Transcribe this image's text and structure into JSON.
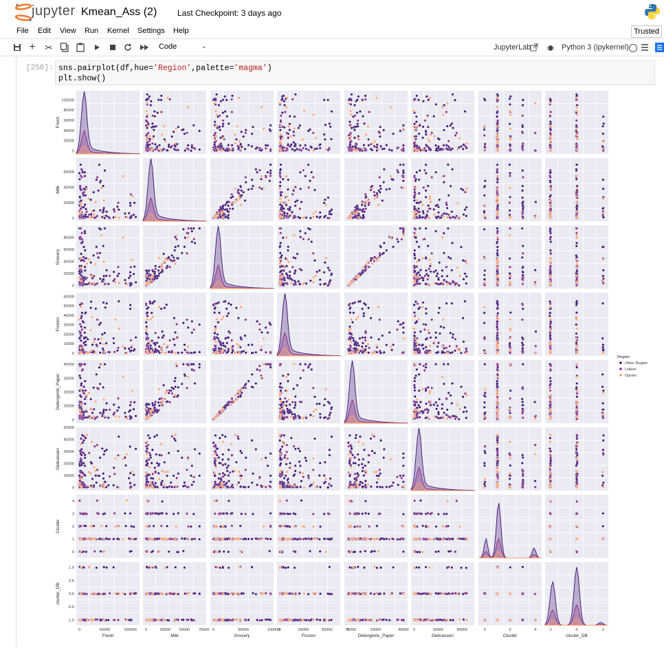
{
  "header": {
    "logo_text": "jupyter",
    "notebook_title": "Kmean_Ass (2)",
    "checkpoint": "Last Checkpoint: 3 days ago"
  },
  "menu": {
    "items": [
      "File",
      "Edit",
      "View",
      "Run",
      "Kernel",
      "Settings",
      "Help"
    ],
    "trusted": "Trusted"
  },
  "toolbar": {
    "icons": [
      "save-icon",
      "add-cell-icon",
      "cut-icon",
      "copy-icon",
      "paste-icon",
      "run-icon",
      "stop-icon",
      "restart-icon",
      "fast-forward-icon"
    ],
    "cell_type": "Code",
    "jupyterlab": "JupyterLab",
    "kernel": "Python 3 (ipykernel)"
  },
  "cell": {
    "prompt": "[250]:",
    "code_line1_fn": "sns.pairplot",
    "code_line1_args_a": "(df,hue=",
    "code_line1_str1": "'Region'",
    "code_line1_args_b": ",palette=",
    "code_line1_str2": "'magma'",
    "code_line1_end": ")",
    "code_line2": "plt.show()"
  },
  "chart_data": {
    "type": "scatter",
    "subtype": "pairplot",
    "variables": [
      "Fresh",
      "Milk",
      "Grocery",
      "Frozen",
      "Detergents_Paper",
      "Delicassen",
      "Cluster",
      "cluster_DB"
    ],
    "hue": "Region",
    "legend": {
      "title": "Region",
      "entries": [
        {
          "name": "Other Region",
          "color": "#3b0f70"
        },
        {
          "name": "Lisbon",
          "color": "#8c2981"
        },
        {
          "name": "Oporto",
          "color": "#fe9f6d"
        }
      ],
      "placement": "right"
    },
    "x_ticks": {
      "Fresh": [
        "0",
        "50000",
        "100000"
      ],
      "Milk": [
        "0",
        "25000",
        "50000",
        "75000"
      ],
      "Grocery": [
        "0",
        "50000",
        "100000"
      ],
      "Frozen": [
        "0",
        "25000",
        "50000",
        "75000"
      ],
      "Detergents_Paper": [
        "0",
        "20000",
        "40000"
      ],
      "Delicassen": [
        "0",
        "20000",
        "40000"
      ],
      "Cluster": [
        "0",
        "2",
        "4"
      ],
      "cluster_DB": [
        "-1",
        "0",
        "1"
      ]
    },
    "y_ticks": {
      "Fresh": [
        "0",
        "20000",
        "40000",
        "60000",
        "80000",
        "100000"
      ],
      "Milk": [
        "0",
        "20000",
        "40000",
        "60000"
      ],
      "Grocery": [
        "0",
        "20000",
        "40000",
        "60000",
        "80000"
      ],
      "Frozen": [
        "0",
        "10000",
        "20000",
        "30000",
        "40000",
        "50000",
        "60000"
      ],
      "Detergents_Paper": [
        "0",
        "10000",
        "20000",
        "30000",
        "40000"
      ],
      "Delicassen": [
        "0",
        "10000",
        "20000",
        "30000",
        "40000",
        "50000"
      ],
      "Cluster": [
        "0",
        "1",
        "2",
        "3",
        "4"
      ],
      "cluster_DB": [
        "-1.0",
        "-0.5",
        "0.0",
        "0.5",
        "1.0"
      ]
    },
    "ranges": {
      "Fresh": [
        -6000,
        118000
      ],
      "Milk": [
        -4000,
        78000
      ],
      "Grocery": [
        -5000,
        100000
      ],
      "Frozen": [
        -3000,
        64000
      ],
      "Detergents_Paper": [
        -2500,
        43000
      ],
      "Delicassen": [
        -2500,
        50000
      ],
      "Cluster": [
        -0.5,
        4.5
      ],
      "cluster_DB": [
        -1.2,
        1.2
      ]
    },
    "background": "#eaeaf2",
    "grid": true
  }
}
